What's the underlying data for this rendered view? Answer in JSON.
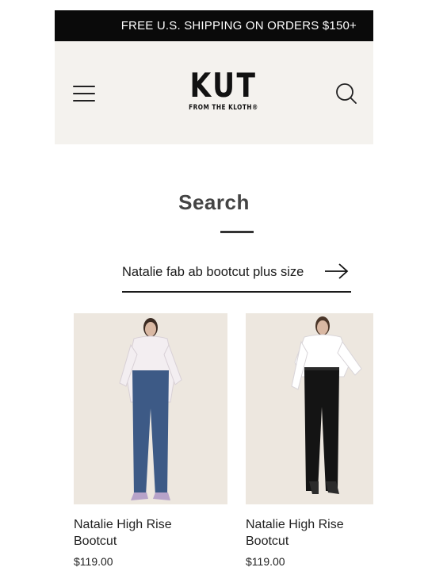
{
  "announcement": {
    "text": "FREE U.S. SHIPPING ON ORDERS $150+"
  },
  "header": {
    "logo_main": "KUT",
    "logo_sub": "FROM THE KLOTH®",
    "menu_icon": "hamburger-menu-icon",
    "search_icon": "search-icon",
    "background": "#f4f2ee"
  },
  "main": {
    "title": "Search",
    "search": {
      "value": "Natalie fab ab bootcut plus size",
      "placeholder": "",
      "submit_icon": "arrow-right-icon"
    }
  },
  "products": [
    {
      "name": "Natalie High Rise Bootcut",
      "price": "$119.00",
      "jeans_color": "#3d5a86",
      "image": "model-in-blue-bootcut-jeans"
    },
    {
      "name": "Natalie High Rise Bootcut",
      "price": "$119.00",
      "jeans_color": "#141414",
      "image": "model-in-black-bootcut-jeans"
    }
  ],
  "colors": {
    "announce_bar": "#0a0a0a",
    "accent": "#1a1a1a"
  }
}
